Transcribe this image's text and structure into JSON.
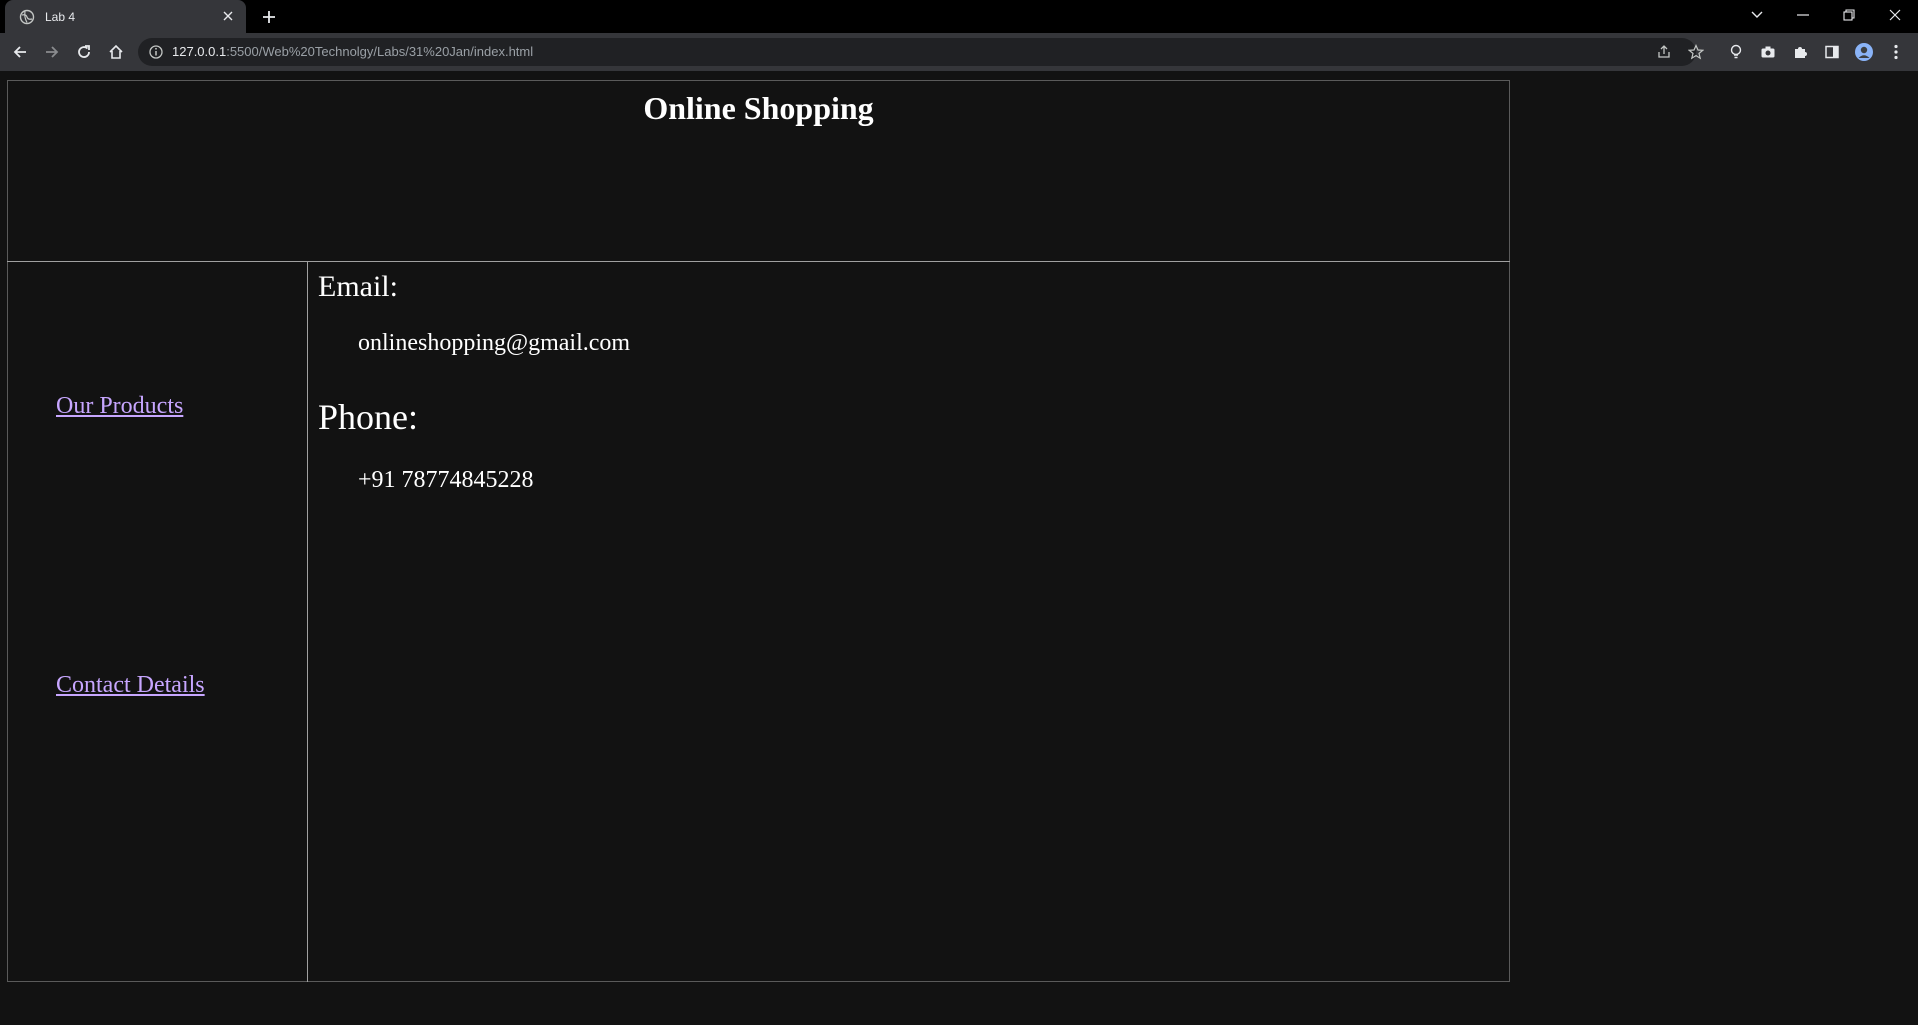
{
  "browser": {
    "tab": {
      "title": "Lab 4"
    },
    "url": {
      "host": "127.0.0.1",
      "path": ":5500/Web%20Technolgy/Labs/31%20Jan/index.html"
    }
  },
  "page": {
    "title": "Online Shopping",
    "nav": {
      "products_label": "Our Products",
      "contact_label": "Contact Details"
    },
    "contact": {
      "email_heading": "Email:",
      "email_value": "onlineshopping@gmail.com",
      "phone_heading": "Phone:",
      "phone_value": "+91 78774845228"
    }
  },
  "colors": {
    "page_bg": "#121212",
    "link": "#c7a6ff",
    "text": "#ffffff",
    "chrome_toolbar": "#35363a"
  }
}
